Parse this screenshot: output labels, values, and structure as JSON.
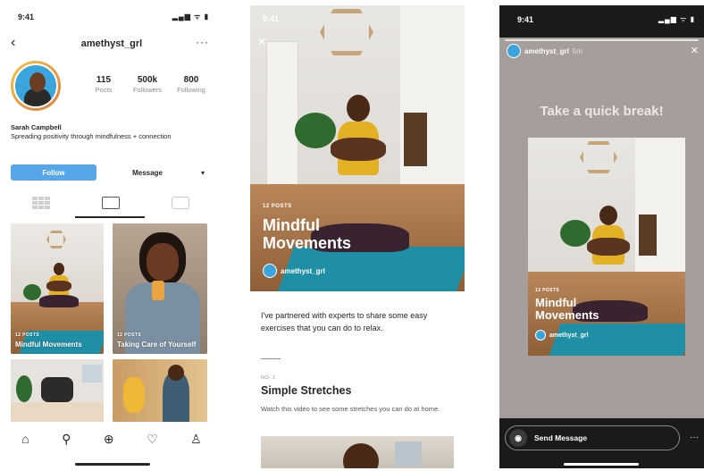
{
  "status": {
    "time": "9:41",
    "icons": "▂▄▆ ᯤ ▮"
  },
  "profile": {
    "back_icon": "‹",
    "username": "amethyst_grl",
    "more_icon": "···",
    "stats": [
      {
        "value": "115",
        "label": "Posts"
      },
      {
        "value": "500k",
        "label": "Followers"
      },
      {
        "value": "800",
        "label": "Following"
      }
    ],
    "name": "Sarah Campbell",
    "bio": "Spreading positivity through mindfulness + connection",
    "follow_label": "Follow",
    "message_label": "Message",
    "dropdown_icon": "▾",
    "tabs": [
      "grid",
      "guides",
      "tagged"
    ],
    "guides": [
      {
        "count": "12 POSTS",
        "title": "Mindful Movements"
      },
      {
        "count": "12 POSTS",
        "title": "Taking Care of Yourself"
      }
    ],
    "bottom_nav": [
      "⌂",
      "⚲",
      "⊕",
      "♡",
      "♙"
    ]
  },
  "guide_view": {
    "time": "9:41",
    "close_icon": "✕",
    "count": "12 POSTS",
    "title": "Mindful Movements",
    "author": "amethyst_grl",
    "intro": "I've partnered with experts to share some easy exercises that you can do to relax.",
    "section_number": "NO. 1",
    "section_title": "Simple Stretches",
    "section_desc": "Watch this video to see some stretches you can do at home."
  },
  "story": {
    "time": "9:41",
    "icons": "▂▄▆ ᯤ ▮",
    "user": "amethyst_grl",
    "ago": "5m",
    "close_icon": "✕",
    "headline": "Take a quick break!",
    "card_count": "12 POSTS",
    "card_title": "Mindful Movements",
    "card_author": "amethyst_grl",
    "camera_icon": "◉",
    "send_label": "Send Message",
    "more_icon": "···"
  },
  "colors": {
    "follow_button": "#58a6ea",
    "mat": "#1f8fa6",
    "top": "#e4b124",
    "story_bg": "#a59e9c"
  }
}
